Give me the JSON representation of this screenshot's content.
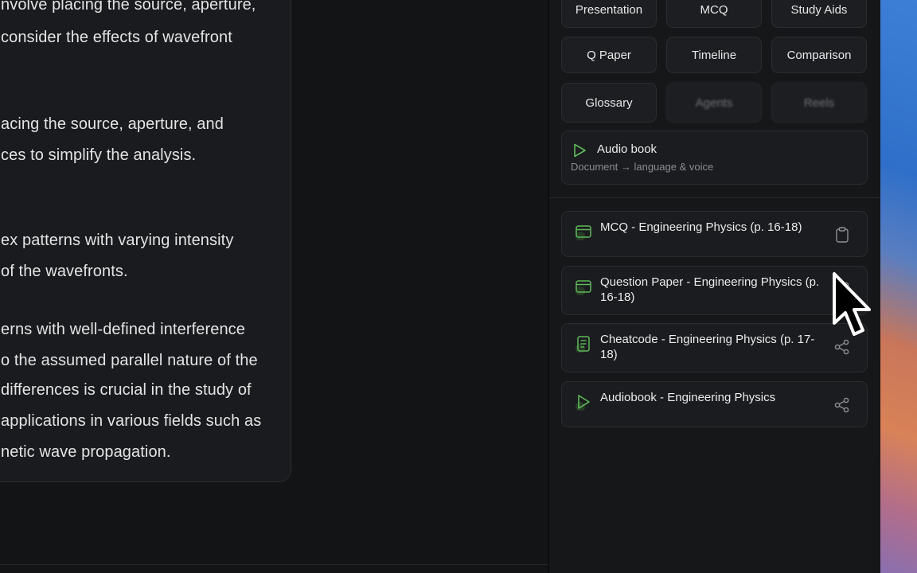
{
  "document": {
    "lines": [
      "nvolve placing the source, aperture,",
      "consider the effects of wavefront",
      "acing the source, aperture, and",
      "ces to simplify the analysis.",
      "ex patterns with varying intensity",
      "of the wavefronts.",
      "erns with well-defined interference",
      "o the assumed parallel nature of the",
      "differences is crucial in the study of",
      "applications in various fields such as",
      "netic wave propagation."
    ]
  },
  "panel": {
    "buttons": [
      {
        "label": "Presentation"
      },
      {
        "label": "MCQ"
      },
      {
        "label": "Study Aids"
      },
      {
        "label": "Q Paper"
      },
      {
        "label": "Timeline"
      },
      {
        "label": "Comparison"
      },
      {
        "label": "Glossary"
      },
      {
        "label": "Agents"
      },
      {
        "label": "Reels"
      }
    ],
    "audio": {
      "title": "Audio book",
      "subtitle": "Document → language & voice"
    },
    "items": [
      {
        "title": "MCQ - Engineering Physics (p. 16-18)",
        "icon": "card-icon",
        "action": "clipboard-icon"
      },
      {
        "title": "Question Paper - Engineering Physics (p. 16-18)",
        "icon": "card-icon",
        "action": "share-icon"
      },
      {
        "title": "Cheatcode - Engineering Physics (p. 17-18)",
        "icon": "document-icon",
        "action": "share-icon"
      },
      {
        "title": "Audiobook - Engineering Physics",
        "icon": "play-icon",
        "action": "share-icon"
      }
    ]
  },
  "colors": {
    "accent": "#5fb85a",
    "background": "#111214",
    "panel": "#161719",
    "card": "#1b1c1f"
  }
}
